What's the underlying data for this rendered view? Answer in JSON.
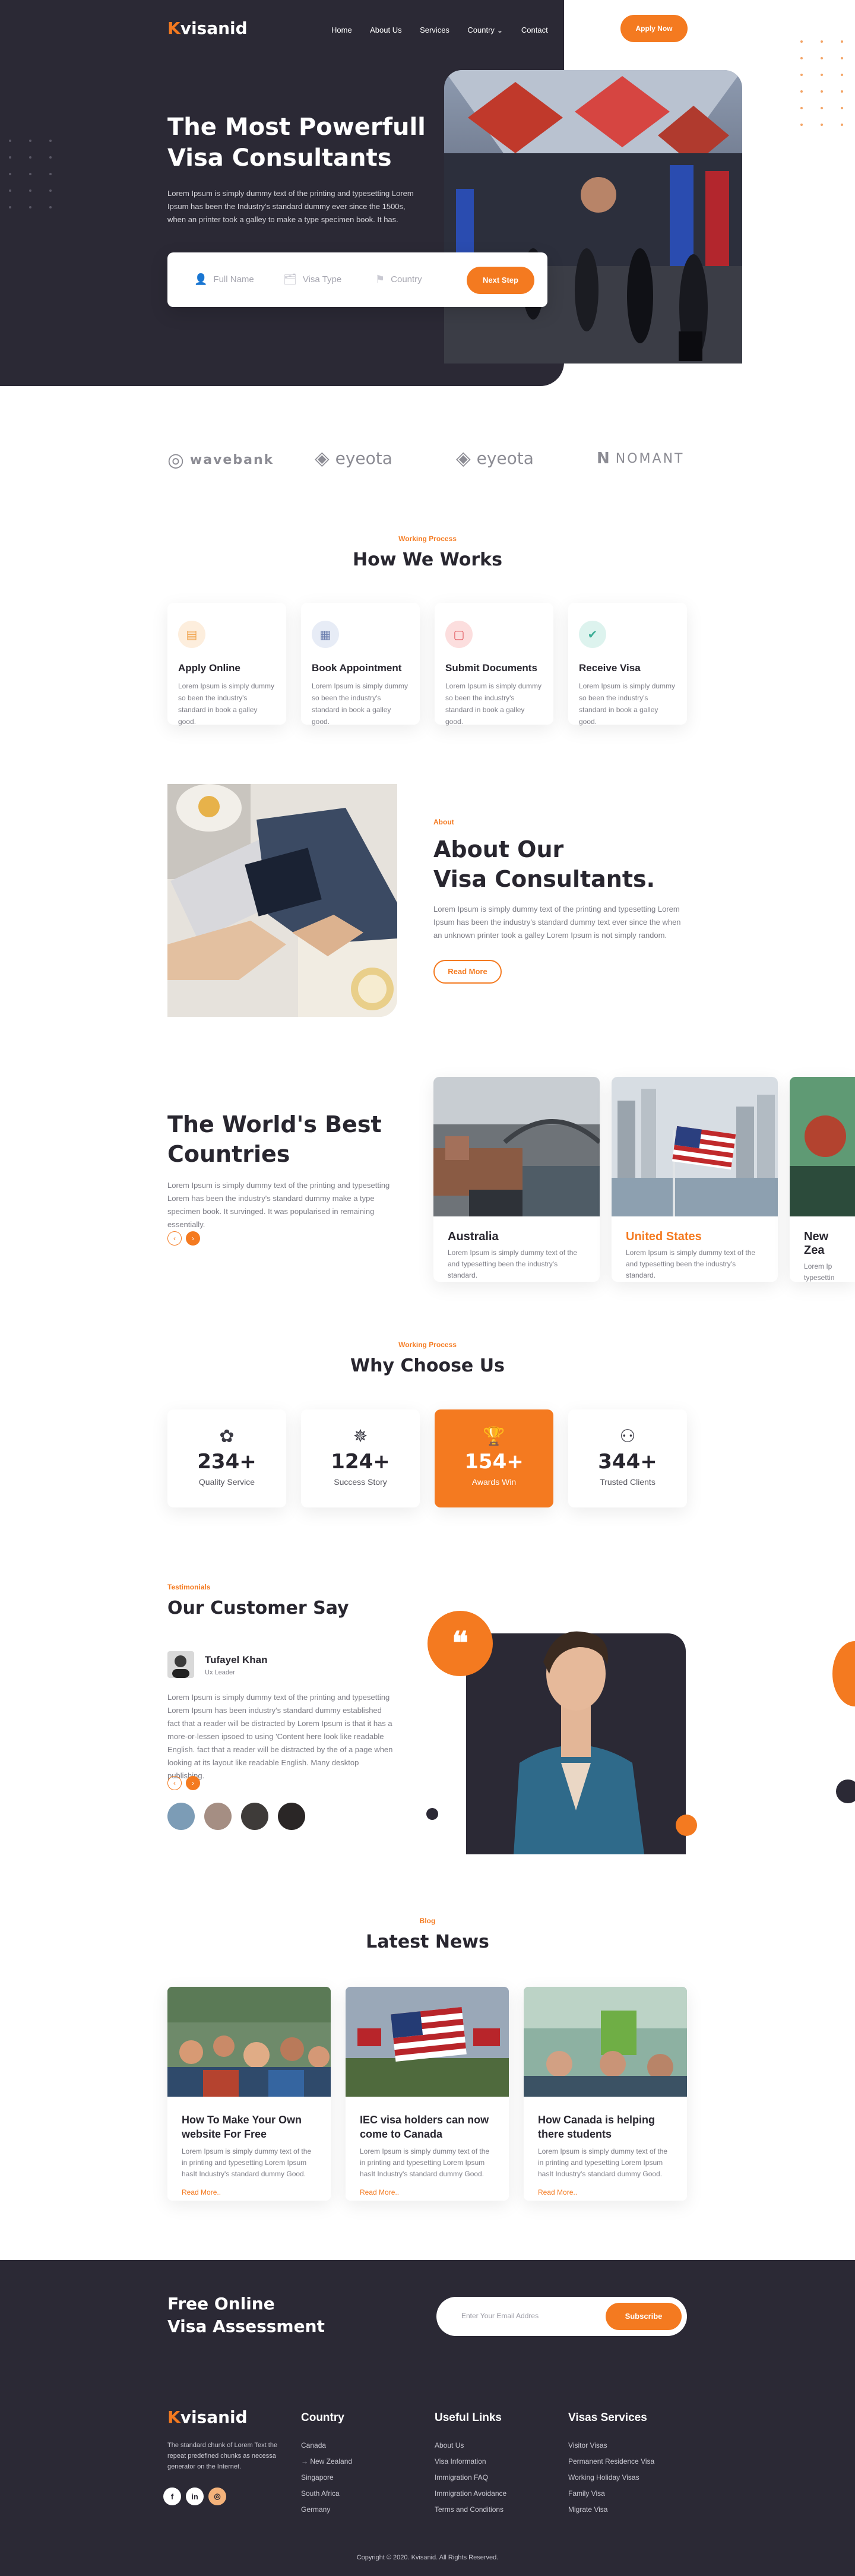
{
  "brand": {
    "k": "K",
    "rest": "visanid"
  },
  "nav": {
    "items": [
      "Home",
      "About Us",
      "Services",
      "Country",
      "Contact"
    ],
    "country_caret": "⌄",
    "apply_label": "Apply Now"
  },
  "hero": {
    "title_line1": "The Most Powerfull",
    "title_line2": "Visa Consultants",
    "description": "Lorem Ipsum is simply dummy text of the printing and typesetting Lorem Ipsum has been the Industry's standard dummy ever since the 1500s, when an printer took a galley to make a type specimen book. It has.",
    "search": {
      "name_placeholder": "Full Name",
      "visa_placeholder": "Visa Type",
      "country_placeholder": "Country",
      "next_label": "Next Step"
    }
  },
  "partners": [
    "wavebank",
    "eyeota",
    "eyeota",
    "NOMANT"
  ],
  "how_we_works": {
    "eyebrow": "Working Process",
    "title": "How We Works",
    "steps": [
      {
        "title": "Apply Online",
        "text": "Lorem Ipsum is simply dummy so been the industry's standard in book a galley good."
      },
      {
        "title": "Book Appointment",
        "text": "Lorem Ipsum is simply dummy so been the industry's standard in book a galley good."
      },
      {
        "title": "Submit Documents",
        "text": "Lorem Ipsum is simply dummy so been the industry's standard in book a galley good."
      },
      {
        "title": "Receive Visa",
        "text": "Lorem Ipsum is simply dummy so been the industry's standard in book a galley good."
      }
    ]
  },
  "about": {
    "eyebrow": "About",
    "title_line1": "About Our",
    "title_line2": "Visa Consultants.",
    "text": "Lorem Ipsum is simply dummy text of the printing and typesetting Lorem Ipsum has been the industry's standard dummy text ever since the when an unknown printer took a galley Lorem Ipsum is not simply random.",
    "button": "Read More"
  },
  "countries": {
    "title_line1": "The World's Best",
    "title_line2": "Countries",
    "text": "Lorem Ipsum is simply dummy text of the printing and typesetting Lorem has been the industry's standard dummy make a type specimen book. It survinged. It was popularised in remaining essentially.",
    "cards": [
      {
        "name": "Australia",
        "text": "Lorem Ipsum is simply dummy text of the and typesetting been the industry's standard."
      },
      {
        "name": "United States",
        "text": "Lorem Ipsum is simply dummy text of the and typesetting been the industry's standard."
      },
      {
        "name": "New Zea",
        "text": "Lorem Ip typesettin"
      }
    ]
  },
  "why": {
    "eyebrow": "Working Process",
    "title": "Why Choose Us",
    "stats": [
      {
        "number": "234+",
        "label": "Quality Service",
        "icon": "✿"
      },
      {
        "number": "124+",
        "label": "Success Story",
        "icon": "✵"
      },
      {
        "number": "154+",
        "label": "Awards Win",
        "icon": "🏆"
      },
      {
        "number": "344+",
        "label": "Trusted Clients",
        "icon": "⚇"
      }
    ]
  },
  "testimonials": {
    "eyebrow": "Testimonials",
    "title": "Our Customer Say",
    "name": "Tufayel Khan",
    "role": "Ux Leader",
    "text": "Lorem Ipsum is simply dummy text of the printing and typesetting Lorem Ipsum has been industry's standard dummy established fact that a reader will be distracted by Lorem Ipsum is that it has a more-or-lessen ipsoed to using 'Content here look like readable English. fact that a reader will be distracted by the of a page when looking at its layout like readable English. Many desktop publishing.",
    "quote_mark": "❝"
  },
  "news": {
    "eyebrow": "Blog",
    "title": "Latest News",
    "items": [
      {
        "title": "How To Make Your Own website For Free",
        "text": "Lorem Ipsum is simply dummy text of the in printing and typesetting Lorem Ipsum hasIt Industry's standard dummy Good.",
        "link": "Read More.."
      },
      {
        "title": "IEC visa holders can now come to Canada",
        "text": "Lorem Ipsum is simply dummy text of the in printing and typesetting Lorem Ipsum hasIt Industry's standard dummy Good.",
        "link": "Read More.."
      },
      {
        "title": "How Canada is helping there students",
        "text": "Lorem Ipsum is simply dummy text of the in printing and typesetting Lorem Ipsum hasIt Industry's standard dummy Good.",
        "link": "Read More.."
      }
    ]
  },
  "assessment": {
    "title_line1": "Free Online",
    "title_line2": "Visa Assessment",
    "email_placeholder": "Enter Your Email Addres",
    "subscribe_label": "Subscribe"
  },
  "footer": {
    "about": "The standard chunk of Lorem Text the repeat predefined chunks as necessa generator on the Internet.",
    "social": [
      "f",
      "in",
      "◎"
    ],
    "country": {
      "title": "Country",
      "links": [
        "Canada",
        "→ New Zealand",
        "Singapore",
        "South Africa",
        "Germany"
      ]
    },
    "useful": {
      "title": "Useful Links",
      "links": [
        "About Us",
        "Visa Information",
        "Immigration FAQ",
        "Immigration Avoidance",
        "Terms and Conditions"
      ]
    },
    "services": {
      "title": "Visas Services",
      "links": [
        "Visitor Visas",
        "Permanent Residence Visa",
        "Working Holiday Visas",
        "Family Visa",
        "Migrate Visa"
      ]
    },
    "copyright": "Copyright © 2020. Kvisanid. All Rights Reserved."
  }
}
